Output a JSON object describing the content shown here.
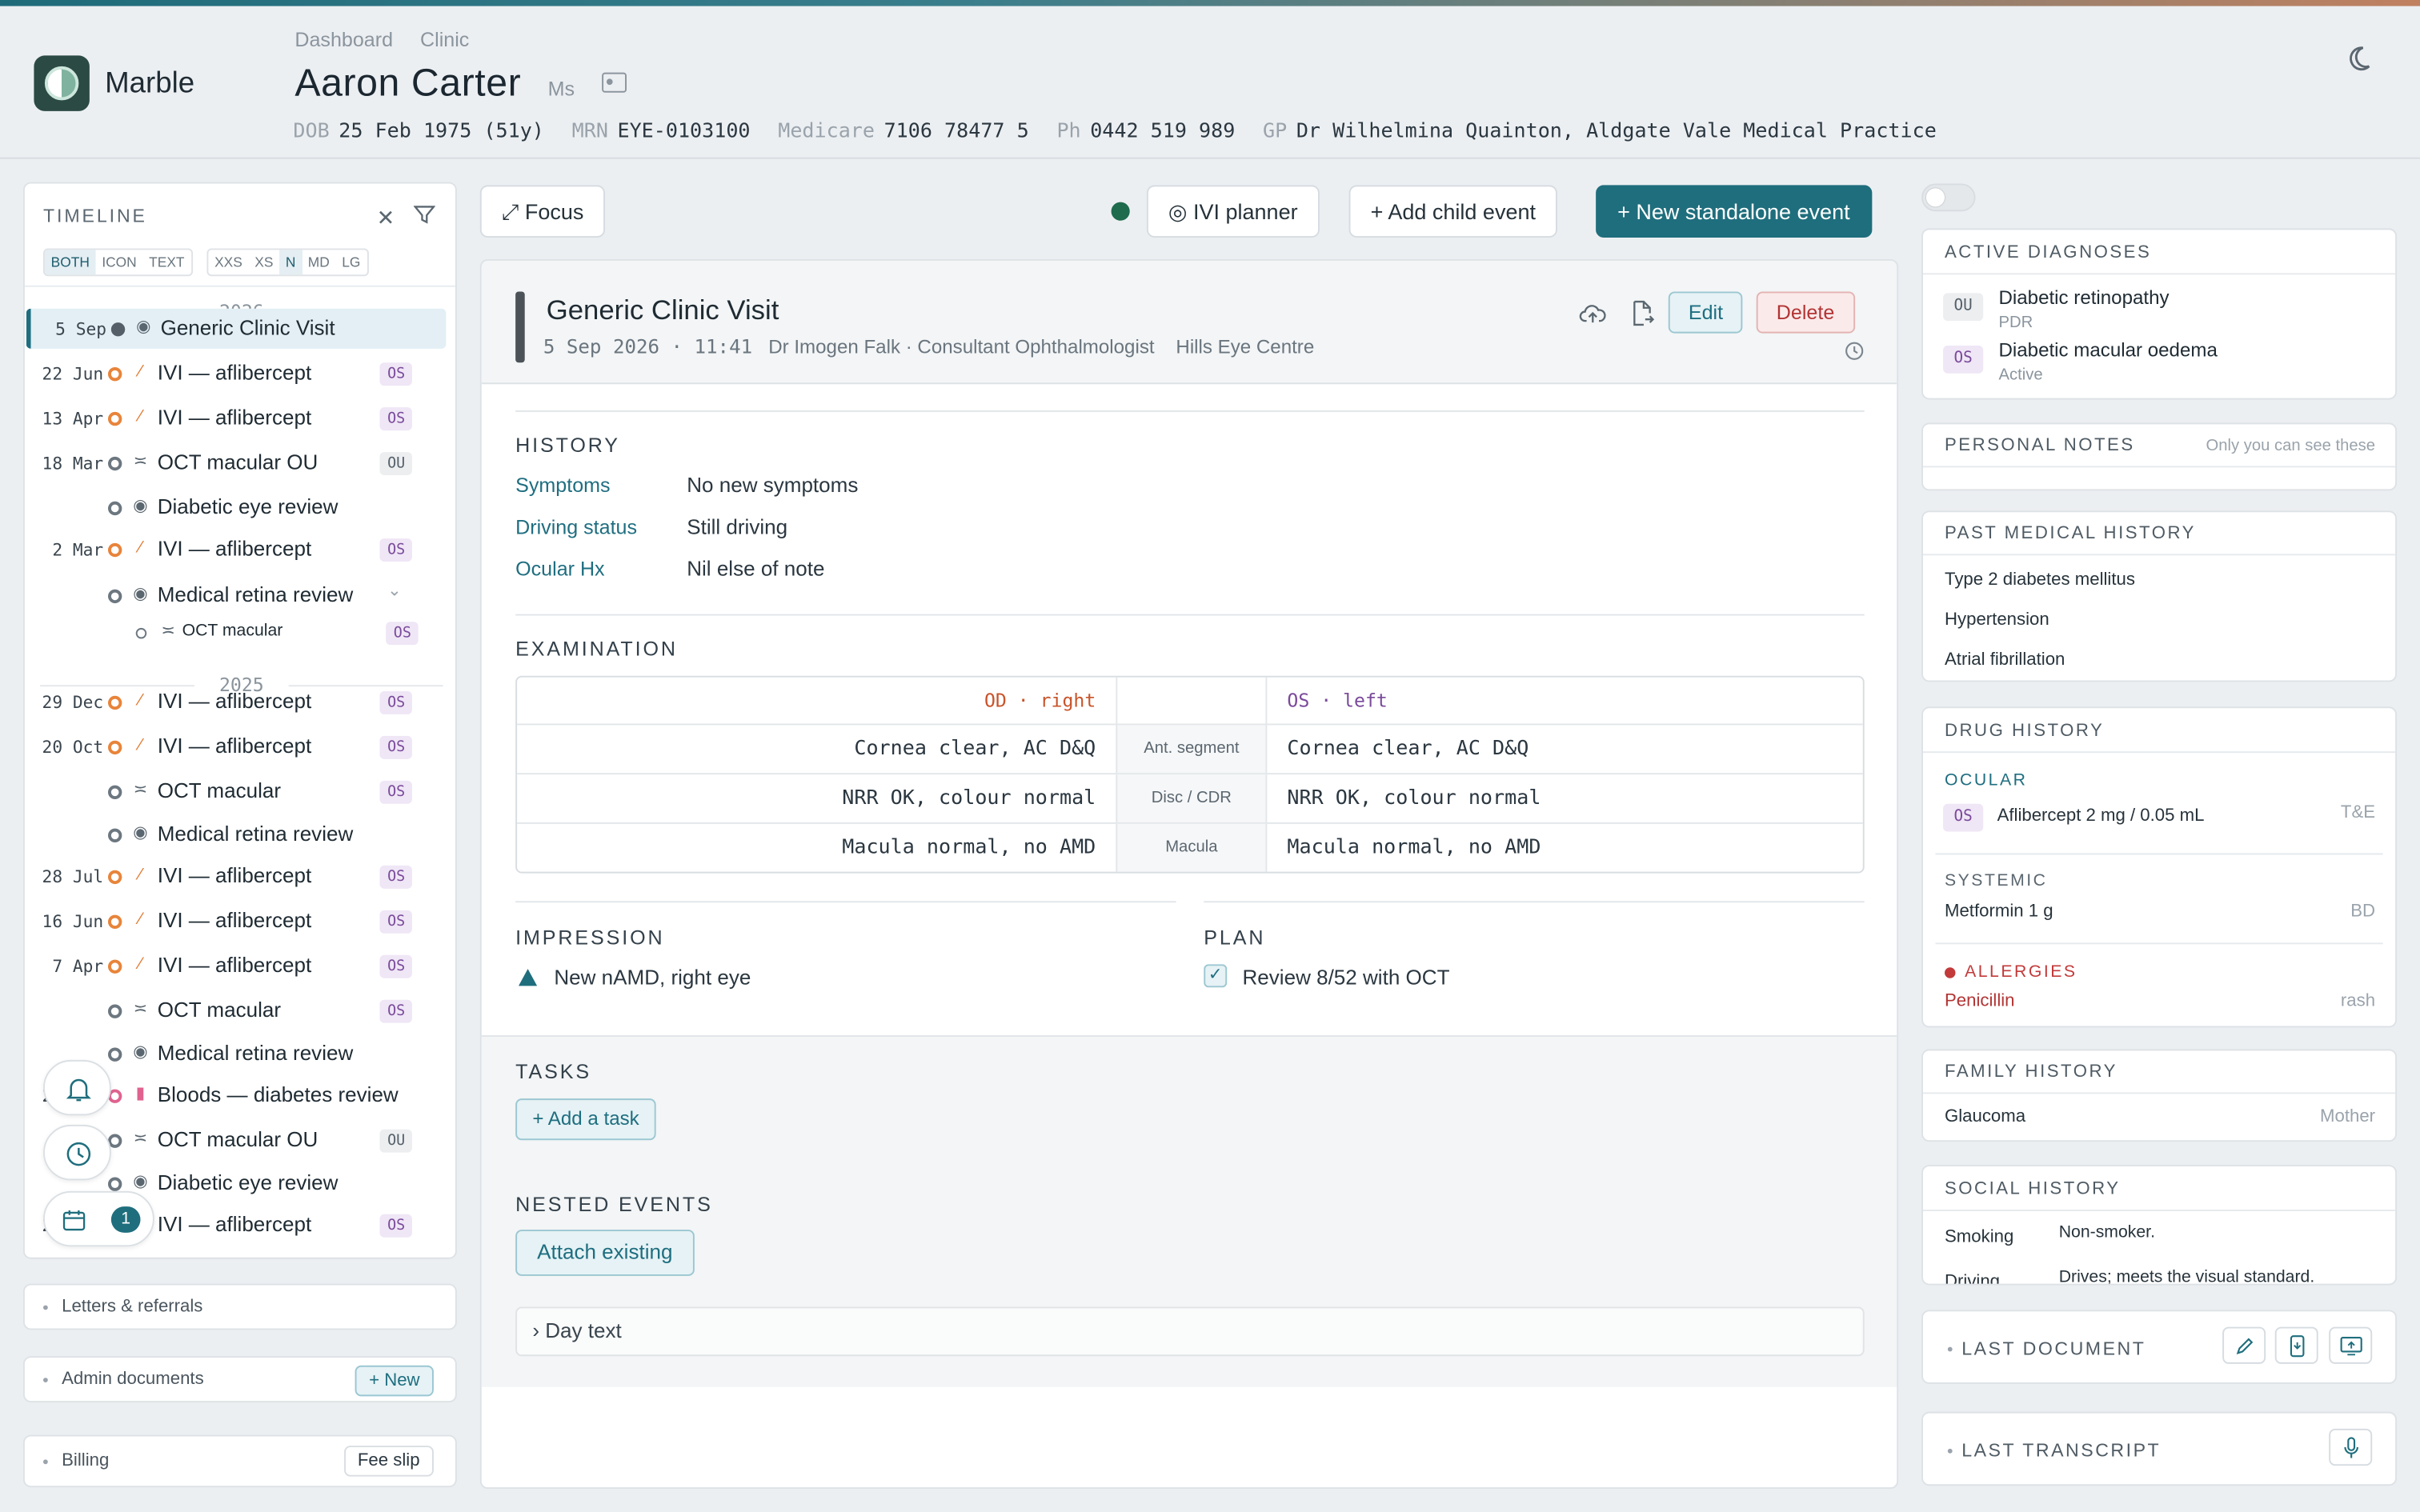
{
  "app": {
    "name": "Marble"
  },
  "breadcrumb": [
    "Dashboard",
    "Clinic"
  ],
  "patient": {
    "name": "Aaron Carter",
    "title": "Ms",
    "dob_label": "DOB",
    "dob": "25 Feb 1975 (51y)",
    "mrn_label": "MRN",
    "mrn": "EYE-0103100",
    "medicare_label": "Medicare",
    "medicare": "7106 78477 5",
    "phone_label": "Ph",
    "phone": "0442 519 989",
    "gp_label": "GP",
    "gp": "Dr Wilhelmina Quainton, Aldgate Vale Medical Practice"
  },
  "timeline": {
    "title": "TIMELINE",
    "modes": [
      "BOTH",
      "ICON",
      "TEXT"
    ],
    "sizes": [
      "XXS",
      "XS",
      "N",
      "MD",
      "LG"
    ],
    "years": [
      "2026",
      "2025"
    ],
    "events": [
      {
        "date": "5 Sep",
        "name": "Generic Clinic Visit",
        "eye": "",
        "icon": "eye-icon",
        "sel": true
      },
      {
        "date": "22 Jun",
        "name": "IVI — aflibercept",
        "eye": "OS",
        "icon": "syringe-icon"
      },
      {
        "date": "13 Apr",
        "name": "IVI — aflibercept",
        "eye": "OS",
        "icon": "syringe-icon"
      },
      {
        "date": "18 Mar",
        "name": "OCT macular OU",
        "eye": "OU",
        "icon": "scan-icon"
      },
      {
        "date": "",
        "name": "Diabetic eye review",
        "eye": "",
        "icon": "eye-icon"
      },
      {
        "date": "2 Mar",
        "name": "IVI — aflibercept",
        "eye": "OS",
        "icon": "syringe-icon"
      },
      {
        "date": "",
        "name": "Medical retina review",
        "eye": "",
        "icon": "eye-icon"
      },
      {
        "date": "",
        "name": "OCT macular",
        "eye": "OS",
        "icon": "scan-icon"
      },
      {
        "date": "29 Dec",
        "name": "IVI — aflibercept",
        "eye": "OS",
        "icon": "syringe-icon"
      },
      {
        "date": "20 Oct",
        "name": "IVI — aflibercept",
        "eye": "OS",
        "icon": "syringe-icon"
      },
      {
        "date": "",
        "name": "OCT macular",
        "eye": "OS",
        "icon": "scan-icon"
      },
      {
        "date": "",
        "name": "Medical retina review",
        "eye": "",
        "icon": "eye-icon"
      },
      {
        "date": "28 Jul",
        "name": "IVI — aflibercept",
        "eye": "OS",
        "icon": "syringe-icon"
      },
      {
        "date": "16 Jun",
        "name": "IVI — aflibercept",
        "eye": "OS",
        "icon": "syringe-icon"
      },
      {
        "date": "7 Apr",
        "name": "IVI — aflibercept",
        "eye": "OS",
        "icon": "syringe-icon"
      },
      {
        "date": "",
        "name": "OCT macular",
        "eye": "OS",
        "icon": "scan-icon"
      },
      {
        "date": "",
        "name": "Medical retina review",
        "eye": "",
        "icon": "eye-icon"
      },
      {
        "date": "22 Mar",
        "name": "Bloods — diabetes review",
        "eye": "",
        "icon": "test-tube-icon"
      },
      {
        "date": "",
        "name": "OCT macular OU",
        "eye": "OU",
        "icon": "scan-icon"
      },
      {
        "date": "",
        "name": "Diabetic eye review",
        "eye": "",
        "icon": "eye-icon"
      },
      {
        "date": "24 Feb",
        "name": "IVI — aflibercept",
        "eye": "OS",
        "icon": "syringe-icon"
      }
    ],
    "badge_count": "1"
  },
  "sidebar_sections": {
    "letters": "Letters & referrals",
    "admin": "Admin documents",
    "admin_btn": "+ New",
    "billing": "Billing",
    "billing_btn": "Fee slip"
  },
  "toolbar": {
    "focus": "⤢ Focus",
    "ivi_planner": "◎ IVI planner",
    "add_child": "+ Add child event",
    "new_standalone": "+ New standalone event"
  },
  "event": {
    "title": "Generic Clinic Visit",
    "date": "5 Sep 2026 · 11:41",
    "clinician": "Dr Imogen Falk · Consultant Ophthalmologist",
    "location": "Hills Eye Centre",
    "edit": "Edit",
    "delete": "Delete",
    "history_title": "HISTORY",
    "history": [
      {
        "k": "Symptoms",
        "v": "No new symptoms"
      },
      {
        "k": "Driving status",
        "v": "Still driving"
      },
      {
        "k": "Ocular Hx",
        "v": "Nil else of note"
      }
    ],
    "exam_title": "EXAMINATION",
    "exam_od": "OD · right",
    "exam_os": "OS · left",
    "exam_rows": [
      {
        "label": "Ant. segment",
        "od": "Cornea clear, AC D&Q",
        "os": "Cornea clear, AC D&Q"
      },
      {
        "label": "Disc / CDR",
        "od": "NRR OK, colour normal",
        "os": "NRR OK, colour normal"
      },
      {
        "label": "Macula",
        "od": "Macula normal, no AMD",
        "os": "Macula normal, no AMD"
      }
    ],
    "impression_title": "IMPRESSION",
    "impression": "New nAMD, right eye",
    "plan_title": "PLAN",
    "plan": "Review 8/52 with OCT",
    "tasks_title": "TASKS",
    "add_task": "+ Add a task",
    "nested_title": "NESTED EVENTS",
    "attach": "Attach existing",
    "day_text": "› Day text"
  },
  "right": {
    "active_dx_title": "ACTIVE DIAGNOSES",
    "dx": [
      {
        "eye": "OU",
        "name": "Diabetic retinopathy",
        "sub": "PDR"
      },
      {
        "eye": "OS",
        "name": "Diabetic macular oedema",
        "sub": "Active"
      }
    ],
    "notes_title": "PERSONAL NOTES",
    "notes_hint": "Only you can see these",
    "pmh_title": "PAST MEDICAL HISTORY",
    "pmh": [
      "Type 2 diabetes mellitus",
      "Hypertension",
      "Atrial fibrillation"
    ],
    "drug_title": "DRUG HISTORY",
    "ocular_label": "OCULAR",
    "ocular_eye": "OS",
    "ocular_drug": "Aflibercept 2 mg / 0.05 mL",
    "ocular_freq": "T&E",
    "systemic_label": "SYSTEMIC",
    "systemic_drug": "Metformin 1 g",
    "systemic_freq": "BD",
    "allergies_label": "ALLERGIES",
    "allergy": "Penicillin",
    "allergy_reaction": "rash",
    "fh_title": "FAMILY HISTORY",
    "fh": "Glaucoma",
    "fh_rel": "Mother",
    "sh_title": "SOCIAL HISTORY",
    "sh": [
      {
        "k": "Smoking",
        "v": "Non-smoker."
      },
      {
        "k": "Driving",
        "v": "Drives; meets the visual standard."
      }
    ],
    "last_doc": "LAST DOCUMENT",
    "last_transcript": "LAST TRANSCRIPT"
  },
  "colors": {
    "accent": "#1f6e7d",
    "danger": "#b23434",
    "syringe": "#e8843a",
    "os_badge": "#7a4a9a"
  }
}
